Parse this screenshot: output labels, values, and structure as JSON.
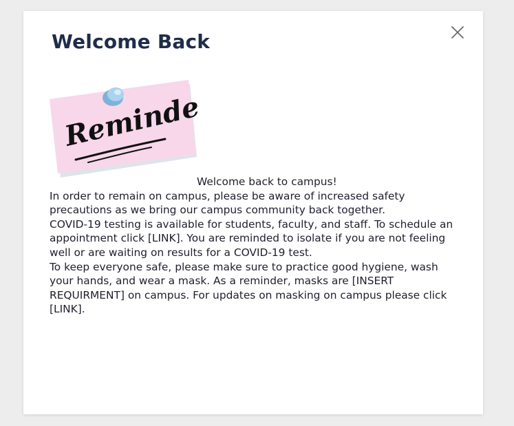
{
  "modal": {
    "title": "Welcome Back",
    "close_icon": "close-icon",
    "image": {
      "icon": "reminder-sticky-note-icon",
      "handwritten_text": "Reminder!",
      "colors": {
        "note": "#f8d7ea",
        "pin": "#8fc3e6",
        "ink": "#111111"
      }
    },
    "body": {
      "lead": "Welcome back to campus!",
      "paragraphs": [
        "In order to remain on campus, please be aware of increased safety precautions as we bring our campus community back together.",
        "COVID-19 testing is available for students, faculty, and staff. To schedule an appointment click [LINK]. You are reminded to isolate if you are not feeling well or are waiting on results for a COVID-19 test.",
        "To keep everyone safe, please make sure to practice good hygiene, wash your hands, and wear a mask. As a reminder, masks are [INSERT REQUIRMENT] on campus. For updates on masking on campus please click [LINK]."
      ]
    }
  },
  "colors": {
    "backdrop": "#ededed",
    "title": "#1f2d4a",
    "text": "#1f1f2e",
    "close": "#6b6b6b"
  }
}
